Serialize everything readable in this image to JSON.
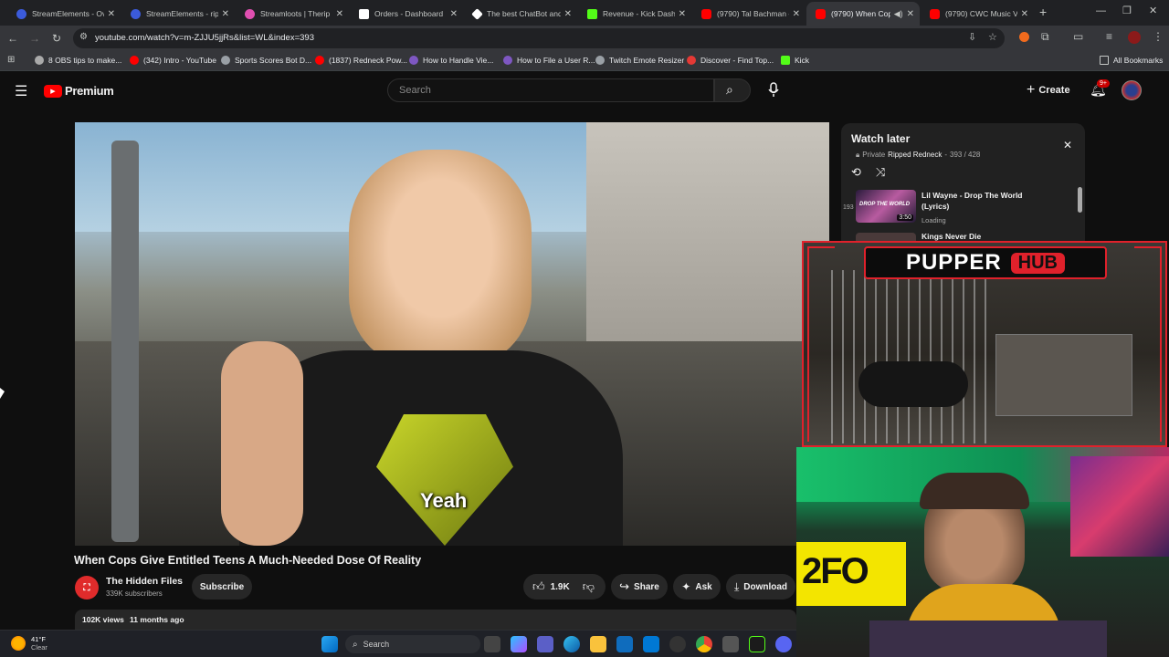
{
  "browser": {
    "tabs": [
      {
        "title": "StreamElements - Ov",
        "color": "#3b5bdb"
      },
      {
        "title": "StreamElements - rip",
        "color": "#3b5bdb"
      },
      {
        "title": "Streamloots | Therip",
        "color": "#e04fb0"
      },
      {
        "title": "Orders - Dashboard",
        "color": "#ffffff"
      },
      {
        "title": "The best ChatBot and",
        "color": "#ffffff"
      },
      {
        "title": "Revenue - Kick Dashb",
        "color": "#53fc18"
      },
      {
        "title": "(9790) Tal Bachman -",
        "color": "#ff0000"
      },
      {
        "title": "(9790) When Cop",
        "color": "#ff0000"
      },
      {
        "title": "(9790) CWC Music Vi",
        "color": "#ff0000"
      }
    ],
    "url": "youtube.com/watch?v=m-ZJJU5jjRs&list=WL&index=393",
    "bookmarks": [
      "8 OBS tips to make...",
      "(342) Intro - YouTube",
      "Sports Scores Bot D...",
      "(1837) Redneck Pow...",
      "How to Handle Vie...",
      "How to File a User R...",
      "Twitch Emote Resizer",
      "Discover - Find Top...",
      "Kick"
    ],
    "all_bookmarks": "All Bookmarks"
  },
  "youtube": {
    "logo_text": "Premium",
    "search_placeholder": "Search",
    "create_label": "Create",
    "notif_badge": "9+",
    "video_caption": "Yeah",
    "video_title": "When Cops Give Entitled Teens A Much-Needed Dose Of Reality",
    "channel_name": "The Hidden Files",
    "subscribers": "339K subscribers",
    "subscribe_label": "Subscribe",
    "likes": "1.9K",
    "share_label": "Share",
    "ask_label": "Ask",
    "download_label": "Download",
    "views": "102K views",
    "posted": "11 months ago",
    "watch_later": {
      "title": "Watch later",
      "private_label": "Private",
      "owner": "Ripped Redneck",
      "position": "393 / 428",
      "items": [
        {
          "index": "193",
          "title": "Lil Wayne - Drop The World (Lyrics)",
          "duration": "3:50",
          "status": "Loading",
          "thumb_text": "DROP THE WORLD"
        },
        {
          "index": "",
          "title": "Kings Never Die",
          "duration": "",
          "status": "",
          "thumb_text": ""
        }
      ]
    }
  },
  "overlay": {
    "brand_left": "PUPPER",
    "brand_right": "HUB",
    "cam_sign": "2FO"
  },
  "taskbar": {
    "temp": "41°F",
    "weather": "Clear",
    "search_label": "Search"
  },
  "colors": {
    "yt_red": "#ff0000",
    "overlay_red": "#e0212b"
  }
}
